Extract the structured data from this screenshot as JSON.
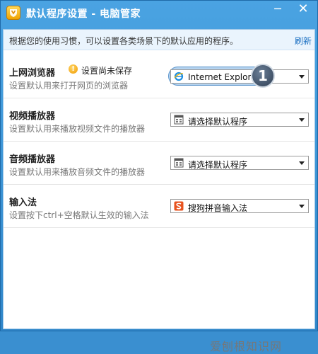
{
  "window": {
    "title": "默认程序设置 - 电脑管家",
    "minimize_glyph": "─",
    "close_glyph": "✕"
  },
  "description_bar": {
    "text": "根据您的使用习惯，可以设置各类场景下的默认应用的程序。",
    "refresh_label": "刷新"
  },
  "rows": [
    {
      "title": "上网浏览器",
      "description": "设置默认用来打开网页的浏览器",
      "warning_text": "设置尚未保存",
      "selected": "Internet Explorer",
      "icon": "ie-icon",
      "badge": "1"
    },
    {
      "title": "视频播放器",
      "description": "设置默认用来播放视频文件的播放器",
      "selected": "请选择默认程序",
      "icon": "app-placeholder-icon"
    },
    {
      "title": "音频播放器",
      "description": "设置默认用来播放音频文件的播放器",
      "selected": "请选择默认程序",
      "icon": "app-placeholder-icon"
    },
    {
      "title": "输入法",
      "description": "设置按下ctrl+空格默认生效的输入法",
      "selected": "搜狗拼音输入法",
      "icon": "sogou-icon"
    }
  ],
  "watermark": "爱刨根知识网",
  "colors": {
    "title_bar": "#3a8fd0",
    "link": "#1a6fc2",
    "warning": "#f09a00"
  }
}
